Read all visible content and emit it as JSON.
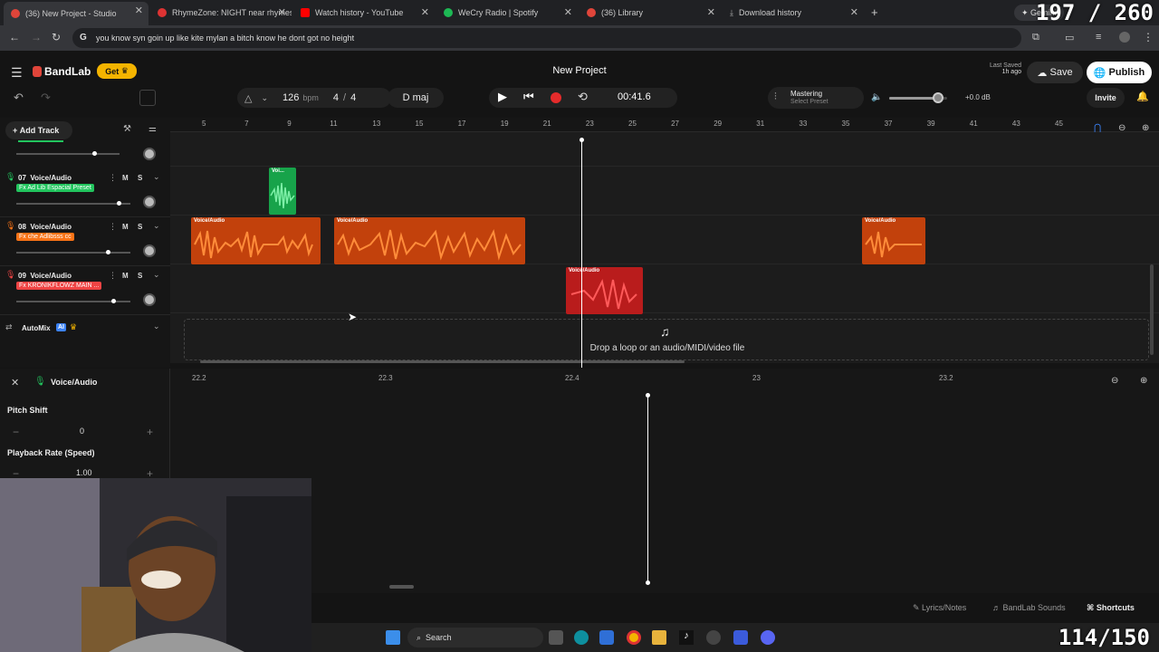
{
  "browser": {
    "tabs": [
      {
        "label": "(36) New Project - Studio",
        "color": "#e0453a",
        "active": true
      },
      {
        "label": "RhymeZone: NIGHT near rhymes",
        "color": "#d33",
        "active": false
      },
      {
        "label": "Watch history - YouTube",
        "color": "#f00",
        "active": false
      },
      {
        "label": "WeCry Radio | Spotify",
        "color": "#1db954",
        "active": false
      },
      {
        "label": "(36) Library",
        "color": "#e0453a",
        "active": false
      },
      {
        "label": "Download history",
        "color": "#aaa",
        "active": false
      }
    ],
    "gemini_label": "Gemini",
    "address": "you know syn goin up like kite mylan a bitch know he dont got no height",
    "frame_counter": "197 / 260"
  },
  "app": {
    "brand": "BandLab",
    "get_label": "Get",
    "project_title": "New Project",
    "last_saved_label": "Last Saved",
    "last_saved_value": "1h ago",
    "save_label": "Save",
    "publish_label": "Publish",
    "invite_label": "Invite"
  },
  "transport": {
    "tempo": "126",
    "tempo_unit": "bpm",
    "time_sig_num": "4",
    "time_sig_den": "4",
    "key": "D maj",
    "time": "00:41.6",
    "mastering_label": "Mastering",
    "mastering_preset": "Select Preset",
    "volume_db": "+0.0 dB",
    "volume_level": 0.85
  },
  "sidebar": {
    "add_track_label": "Add Track",
    "tracks": [
      {
        "num": "07",
        "name": "Voice/Audio",
        "fx": "Fx Ad Lib Espacial Preset",
        "fx_color": "#22c55e",
        "vol": 0.9
      },
      {
        "num": "08",
        "name": "Voice/Audio",
        "fx": "Fx che Adlibsss cc",
        "fx_color": "#f97316",
        "vol": 0.8
      },
      {
        "num": "09",
        "name": "Voice/Audio",
        "fx": "Fx KRONIKFLOWZ MAIN ...",
        "fx_color": "#ef4444",
        "vol": 0.85
      }
    ],
    "m_label": "M",
    "s_label": "S",
    "automix_label": "AutoMix",
    "ai_label": "AI"
  },
  "ruler": {
    "ticks": [
      "5",
      "7",
      "9",
      "11",
      "13",
      "15",
      "17",
      "19",
      "21",
      "23",
      "25",
      "27",
      "29",
      "31",
      "33",
      "35",
      "37",
      "39",
      "41",
      "43",
      "45"
    ]
  },
  "clips": {
    "label_short": "Voi...",
    "label": "Voice/Audio"
  },
  "drop_zone": "Drop a loop or an audio/MIDI/video file",
  "editor": {
    "track_name": "Voice/Audio",
    "ticks": [
      "22.2",
      "22.3",
      "22.4",
      "23",
      "23.2"
    ],
    "pitch_label": "Pitch Shift",
    "pitch_value": "0",
    "rate_label": "Playback Rate (Speed)",
    "rate_value": "1.00"
  },
  "footer": {
    "lyrics_label": "Lyrics/Notes",
    "sounds_label": "BandLab Sounds",
    "shortcuts_label": "Shortcuts"
  },
  "taskbar": {
    "search_label": "Search",
    "counter": "114/150"
  }
}
